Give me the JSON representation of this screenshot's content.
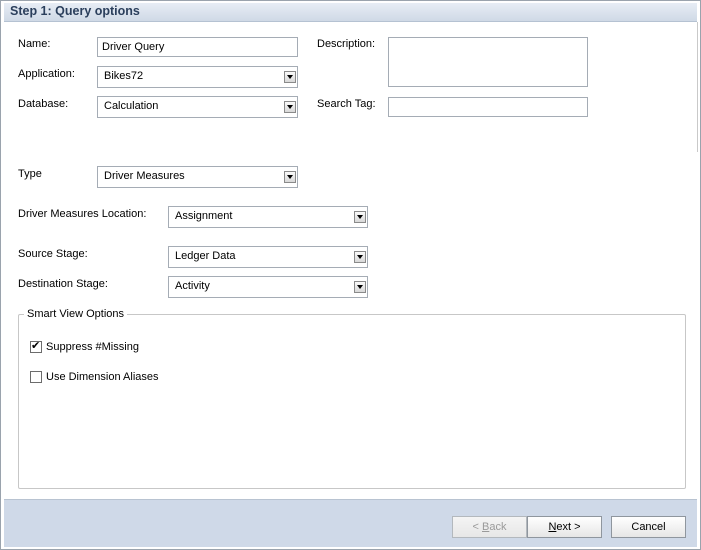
{
  "header": {
    "title": "Step 1: Query options"
  },
  "form": {
    "name": {
      "label": "Name:",
      "value": "Driver Query"
    },
    "description": {
      "label": "Description:",
      "value": ""
    },
    "application": {
      "label": "Application:",
      "value": "Bikes72"
    },
    "database": {
      "label": "Database:",
      "value": "Calculation"
    },
    "search_tag": {
      "label": "Search Tag:",
      "value": ""
    },
    "type": {
      "label": "Type",
      "value": "Driver Measures"
    },
    "driver_measures_location": {
      "label": "Driver Measures Location:",
      "value": "Assignment"
    },
    "source_stage": {
      "label": "Source Stage:",
      "value": "Ledger Data"
    },
    "destination_stage": {
      "label": "Destination Stage:",
      "value": "Activity"
    }
  },
  "smart_view": {
    "legend": "Smart View Options",
    "suppress_missing": {
      "label": "Suppress #Missing",
      "checked": true
    },
    "use_aliases": {
      "label": "Use Dimension Aliases",
      "checked": false
    }
  },
  "footer": {
    "back_prefix": "< ",
    "back_mnemonic": "B",
    "back_rest": "ack",
    "next_mnemonic": "N",
    "next_rest": "ext >",
    "cancel": "Cancel"
  }
}
